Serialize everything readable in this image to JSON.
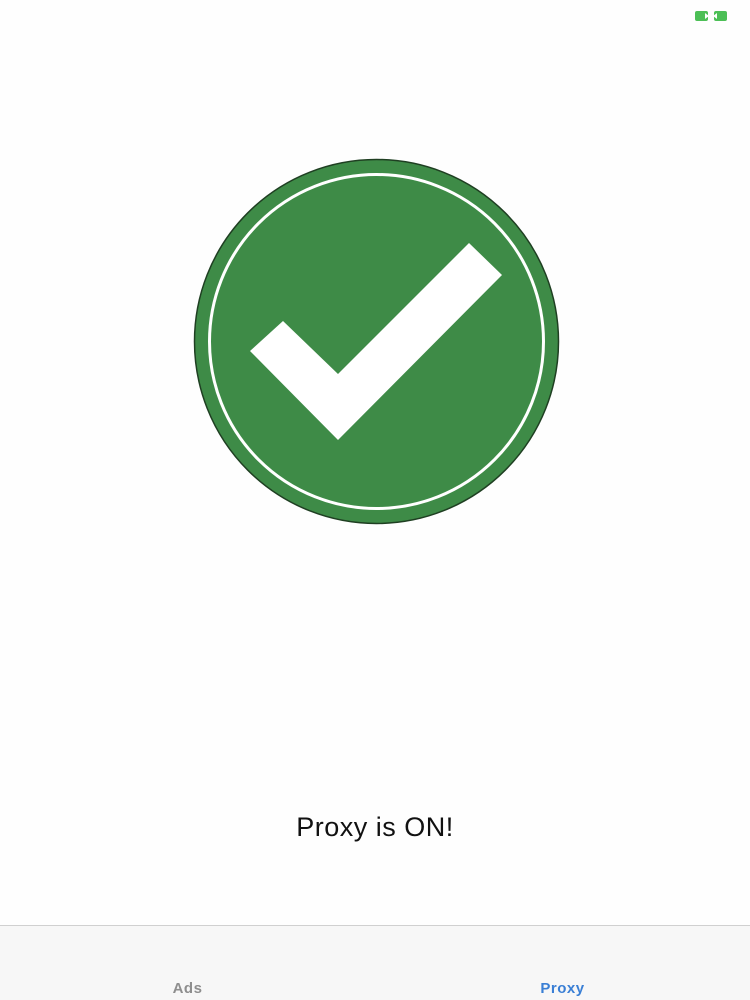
{
  "status": {
    "message": "Proxy is ON!",
    "state_icon": "checkmark-circle-icon",
    "connection_icon": "connection-indicator-icon",
    "accent_color": "#3e8b47"
  },
  "tabbar": {
    "selected": "Proxy",
    "active_color": "#3a7fd5",
    "inactive_color": "#8e8e8e",
    "tabs": [
      {
        "label": "Ads"
      },
      {
        "label": "Proxy"
      }
    ]
  }
}
